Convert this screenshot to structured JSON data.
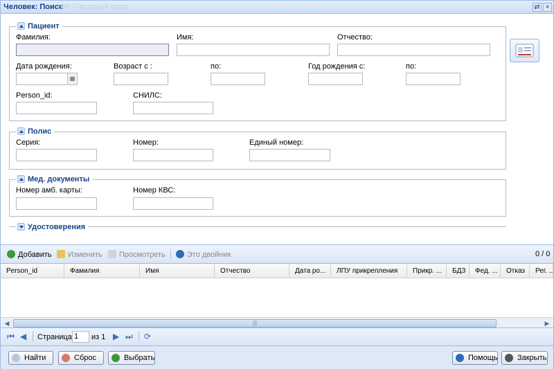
{
  "title": "Человек: Поиск",
  "title_ghost": "Ф8 (Тестовый ввод",
  "sections": {
    "patient": "Пациент",
    "policy": "Полис",
    "med_docs": "Мед. документы",
    "ids": "Удостоверения"
  },
  "labels": {
    "surname": "Фамилия:",
    "name": "Имя:",
    "patronymic": "Отчество:",
    "birth_date": "Дата рождения:",
    "age_from": "Возраст с :",
    "age_to": "по:",
    "birth_year_from": "Год рождения с:",
    "birth_year_to": "по:",
    "person_id": "Person_id:",
    "snils": "СНИЛС:",
    "series": "Серия:",
    "number": "Номер:",
    "unified_number": "Единый номер:",
    "amb_card": "Номер амб. карты:",
    "kvs": "Номер КВС:"
  },
  "toolbar": {
    "add": "Добавить",
    "edit": "Изменить",
    "view": "Просмотреть",
    "twin": "Это двойник",
    "count": "0 / 0"
  },
  "columns": [
    "Person_id",
    "Фамилия",
    "Имя",
    "Отчество",
    "Дата ро...",
    "ЛПУ прикрепления",
    "Прикр. ...",
    "БДЗ",
    "Фед. ...",
    "Отказ",
    "Рег. ..."
  ],
  "pager": {
    "page_label": "Страница",
    "page_value": "1",
    "of_label": "из 1"
  },
  "buttons": {
    "find": "Найти",
    "reset": "Сброс",
    "select": "Выбрать",
    "help": "Помощь",
    "close": "Закрыть"
  },
  "colors": {
    "accent": "#15428b",
    "border": "#99bbe8"
  }
}
